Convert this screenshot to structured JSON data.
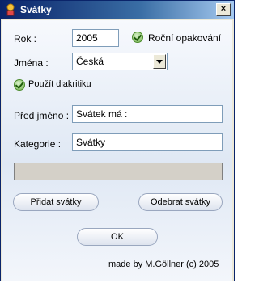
{
  "window": {
    "title": "Svátky"
  },
  "form": {
    "rok_label": "Rok :",
    "rok_value": "2005",
    "repeat_label": "Roční opakování",
    "jmena_label": "Jména :",
    "jmena_value": "Česká",
    "diacritics_label": "Použít diakritiku",
    "pred_label": "Před jméno :",
    "pred_value": "Svátek má :",
    "kategorie_label": "Kategorie :",
    "kategorie_value": "Svátky"
  },
  "buttons": {
    "add": "Přidat svátky",
    "remove": "Odebrat svátky",
    "ok": "OK"
  },
  "footer": {
    "credit": "made by M.Göllner (c) 2005"
  },
  "colors": {
    "titlebar": "#0a246a",
    "check": "#6fb04a"
  }
}
